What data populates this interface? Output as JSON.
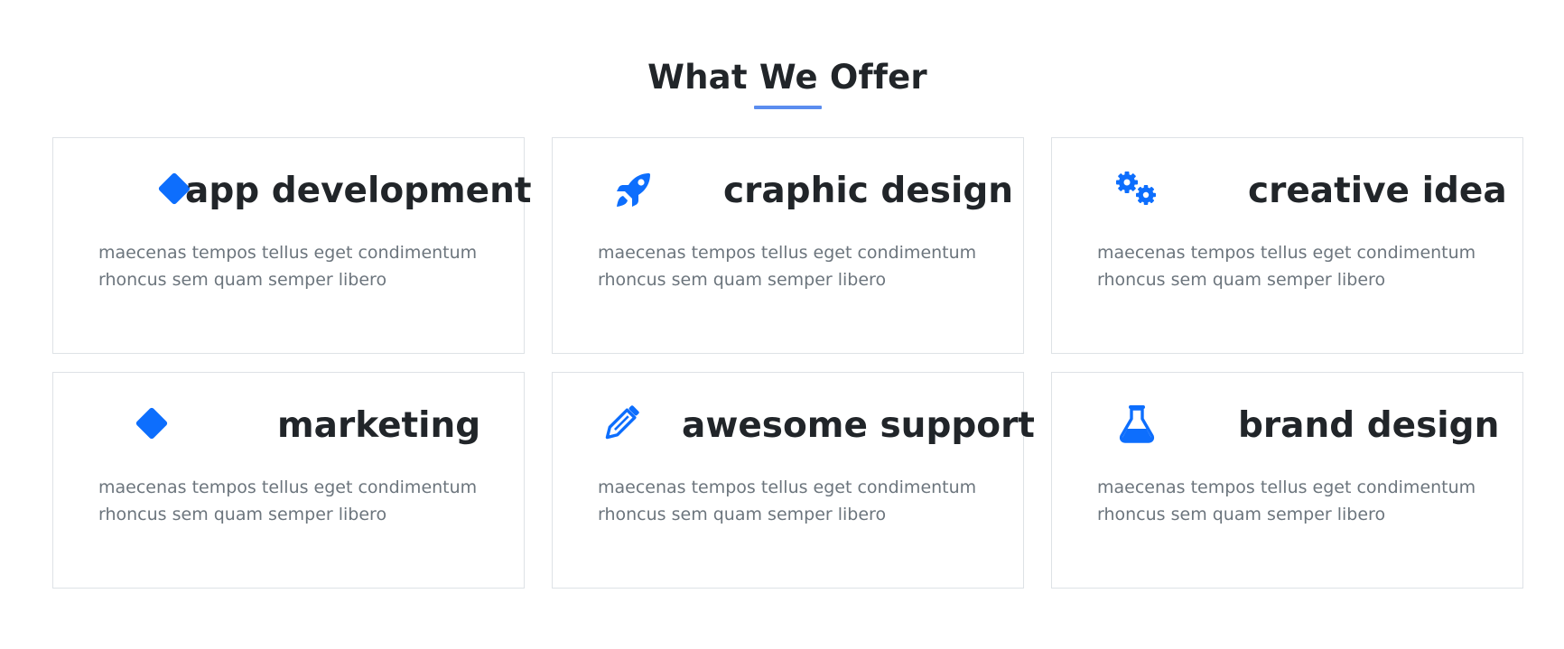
{
  "section": {
    "title": "What We Offer"
  },
  "services": [
    {
      "icon": "diamond-icon",
      "title": "app development",
      "description": "maecenas tempos tellus eget condimentum rhoncus sem quam semper libero"
    },
    {
      "icon": "rocket-icon",
      "title": "craphic design",
      "description": "maecenas tempos tellus eget condimentum rhoncus sem quam semper libero"
    },
    {
      "icon": "gears-icon",
      "title": "creative idea",
      "description": "maecenas tempos tellus eget condimentum rhoncus sem quam semper libero"
    },
    {
      "icon": "diamond-icon",
      "title": "marketing",
      "description": "maecenas tempos tellus eget condimentum rhoncus sem quam semper libero"
    },
    {
      "icon": "pencil-icon",
      "title": "awesome support",
      "description": "maecenas tempos tellus eget condimentum rhoncus sem quam semper libero"
    },
    {
      "icon": "flask-icon",
      "title": "brand design",
      "description": "maecenas tempos tellus eget condimentum rhoncus sem quam semper libero"
    }
  ],
  "colors": {
    "accent": "#0d6efd",
    "underline": "#5b8def",
    "title_text": "#212529",
    "body_text": "#6c757d",
    "card_border": "#dee2e6"
  }
}
